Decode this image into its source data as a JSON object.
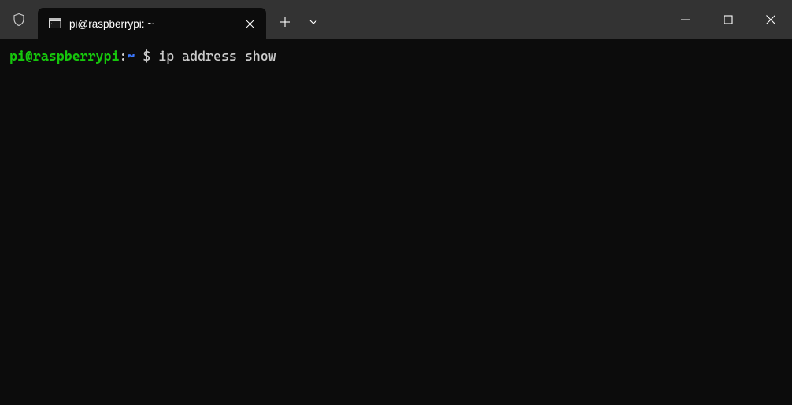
{
  "tab": {
    "title": "pi@raspberrypi: ~"
  },
  "prompt": {
    "user_host": "pi@raspberrypi",
    "colon": ":",
    "path": "~",
    "symbol": " $ ",
    "command": "ip address show"
  }
}
